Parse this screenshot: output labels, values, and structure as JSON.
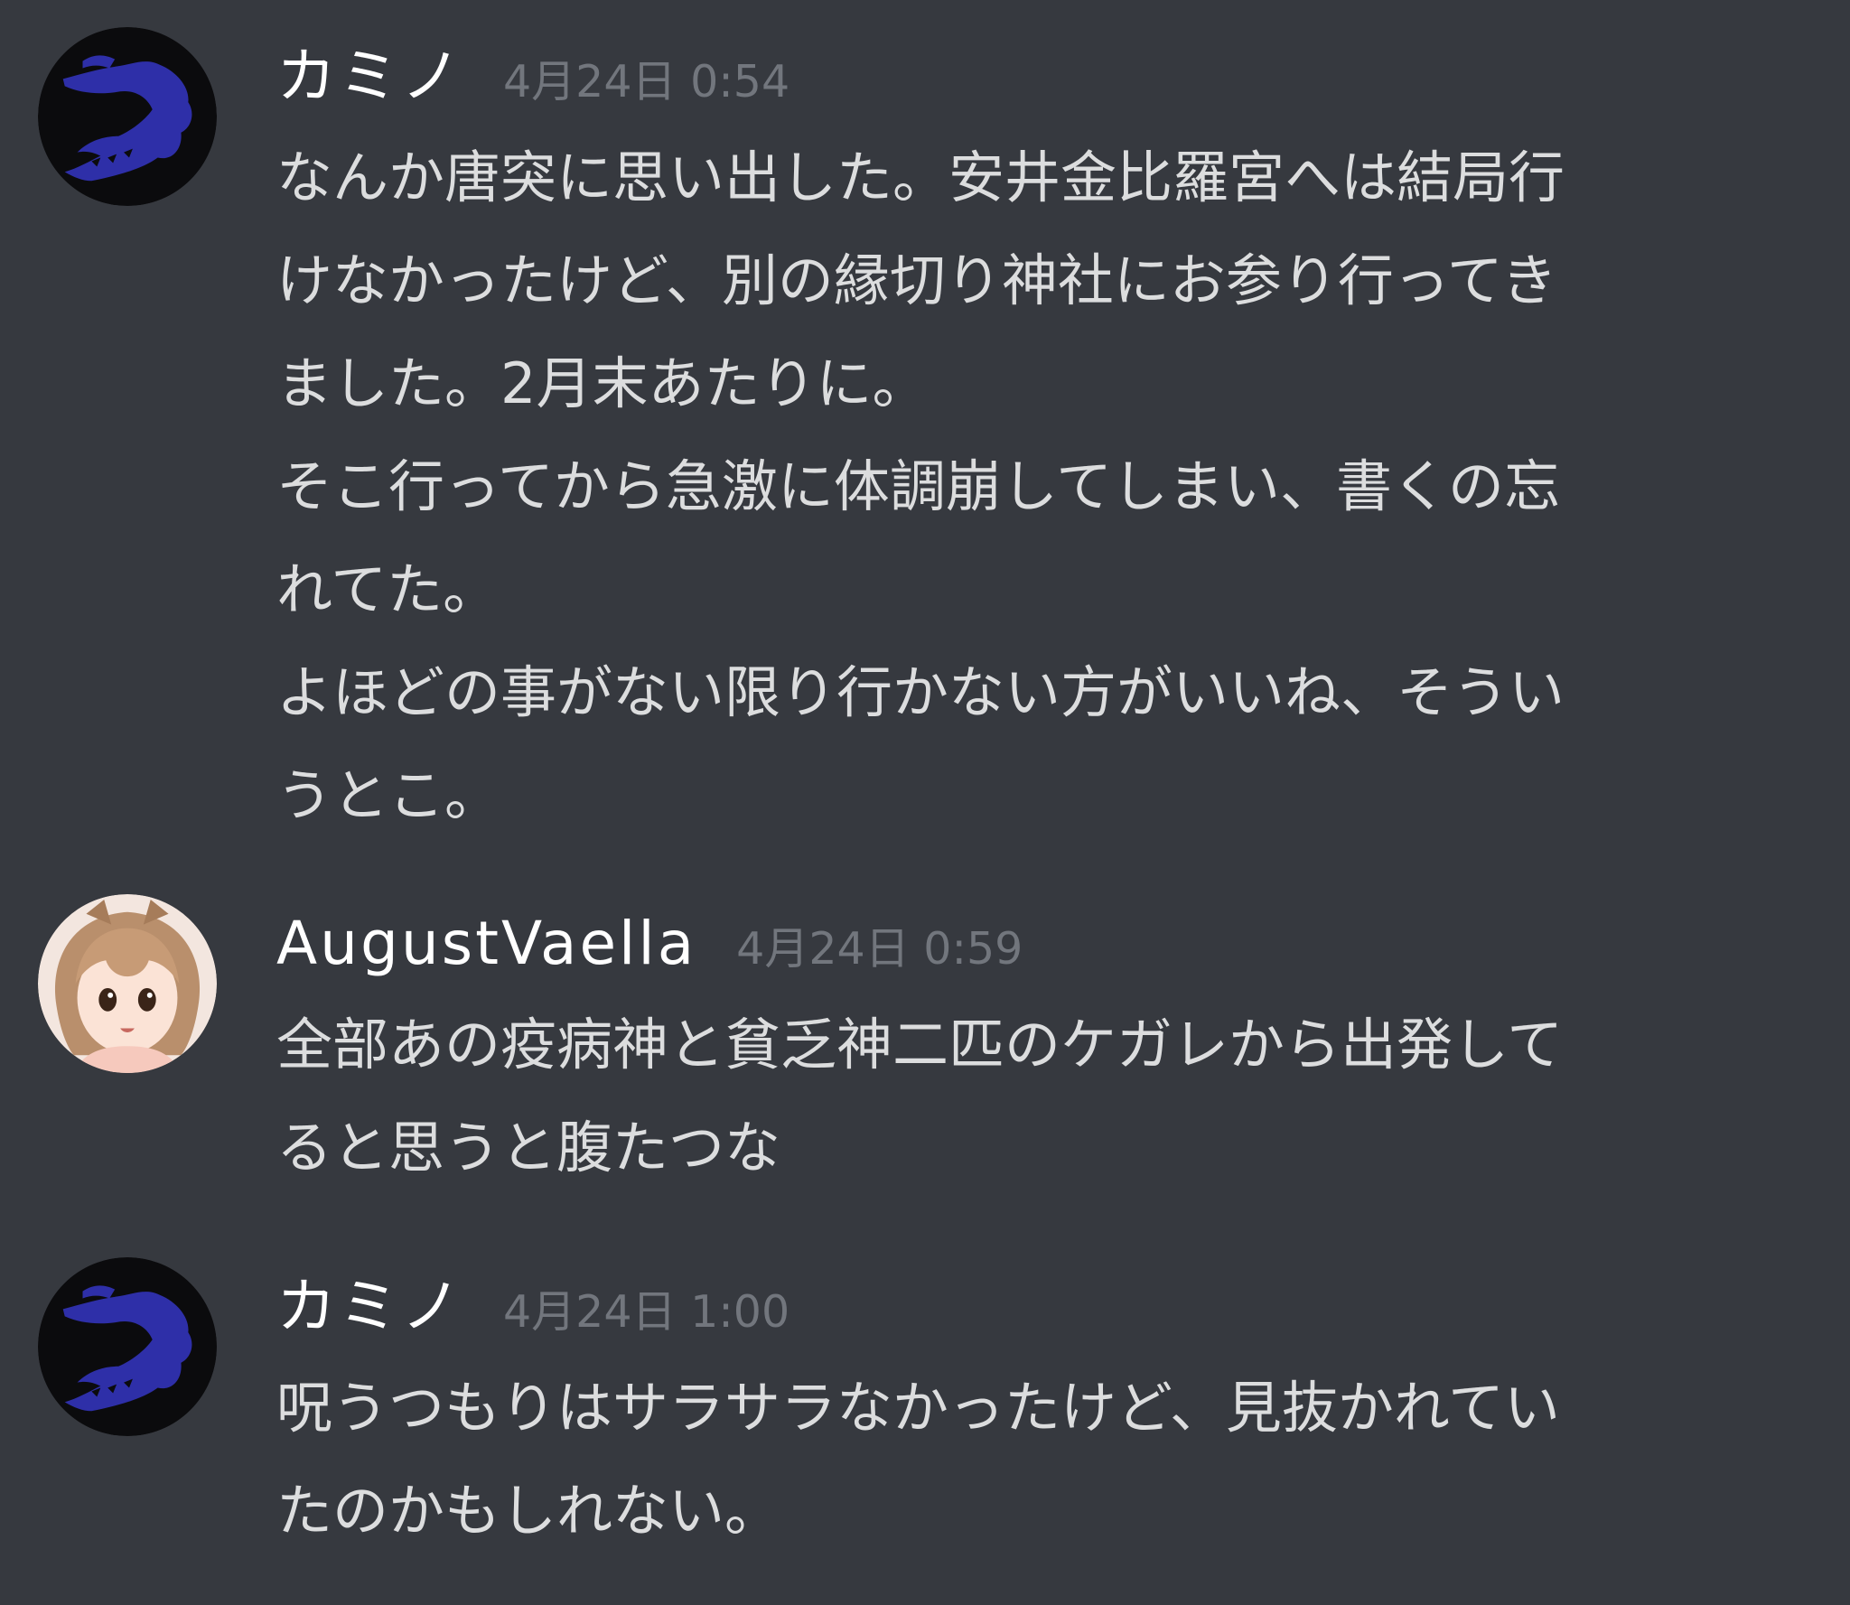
{
  "messages": [
    {
      "username": "カミノ",
      "timestamp": "4月24日 0:54",
      "avatar_icon": "crocodile-icon",
      "lines": [
        "なんか唐突に思い出した。安井金比羅宮へは結局行",
        "けなかったけど、別の縁切り神社にお参り行ってき",
        "ました。2月末あたりに。",
        "そこ行ってから急激に体調崩してしまい、書くの忘",
        "れてた。",
        "よほどの事がない限り行かない方がいいね、そうい",
        "うとこ。"
      ]
    },
    {
      "username": "AugustVaella",
      "timestamp": "4月24日 0:59",
      "avatar_icon": "anime-girl-avatar",
      "lines": [
        "全部あの疫病神と貧乏神二匹のケガレから出発して",
        "ると思うと腹たつな"
      ]
    },
    {
      "username": "カミノ",
      "timestamp": "4月24日 1:00",
      "avatar_icon": "crocodile-icon",
      "lines": [
        "呪うつもりはサラサラなかったけど、見抜かれてい",
        "たのかもしれない。"
      ]
    }
  ],
  "colors": {
    "background": "#36393f",
    "username": "#ffffff",
    "timestamp": "#72767d",
    "text": "#dcddde",
    "crocodile": "#2e2fa8"
  }
}
